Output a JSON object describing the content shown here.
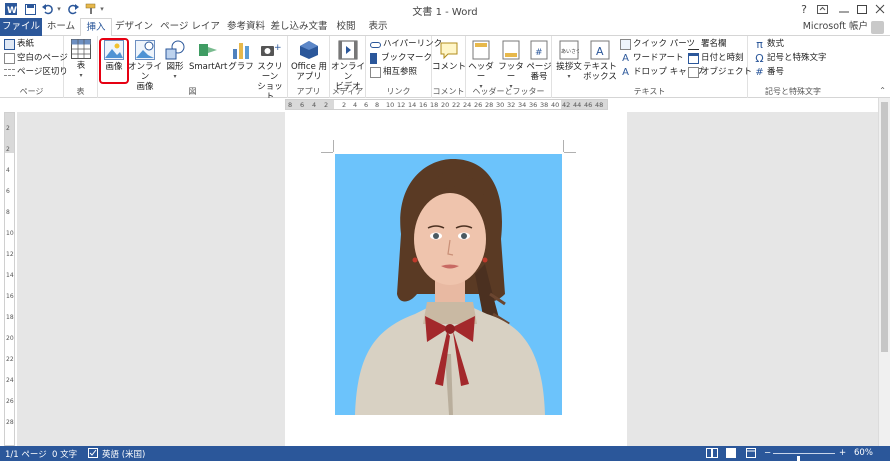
{
  "window": {
    "title": "文書 1 - Word",
    "help": "?",
    "account": "Microsoft 帳户"
  },
  "tabs": [
    {
      "label": "ファイル"
    },
    {
      "label": "ホーム"
    },
    {
      "label": "挿入"
    },
    {
      "label": "デザイン"
    },
    {
      "label": "ページ レイアウト"
    },
    {
      "label": "参考資料"
    },
    {
      "label": "差し込み文書"
    },
    {
      "label": "校閲"
    },
    {
      "label": "表示"
    }
  ],
  "ribbon": {
    "page_group": {
      "label": "ページ",
      "items": [
        "表紙",
        "空白のページ",
        "ページ区切り"
      ]
    },
    "table_group": {
      "label": "表",
      "table": "表"
    },
    "illustrations_group": {
      "label": "図",
      "picture": "画像",
      "online_picture_1": "オンライン",
      "online_picture_2": "画像",
      "shapes": "図形",
      "smartart": "SmartArt",
      "chart": "グラフ",
      "screenshot_1": "スクリーン",
      "screenshot_2": "ショット"
    },
    "apps_group": {
      "label": "アプリ",
      "office_apps_1": "Office 用",
      "office_apps_2": "アプリ"
    },
    "media_group": {
      "label": "メディア",
      "online_video_1": "オンライン",
      "online_video_2": "ビデオ"
    },
    "links_group": {
      "label": "リンク",
      "items": [
        "ハイパーリンク",
        "ブックマーク",
        "相互参照"
      ]
    },
    "comments_group": {
      "label": "コメント",
      "comment": "コメント"
    },
    "header_footer_group": {
      "label": "ヘッダーとフッター",
      "header": "ヘッダー",
      "footer": "フッター",
      "page_number_1": "ページ",
      "page_number_2": "番号"
    },
    "text_group": {
      "label": "テキスト",
      "greeting": "挨拶文",
      "textbox_1": "テキスト",
      "textbox_2": "ボックス",
      "quick_parts": "クイック パーツ",
      "wordart": "ワードアート",
      "dropcap": "ドロップ キャップ",
      "signature": "署名欄",
      "datetime": "日付と時刻",
      "object": "オブジェクト"
    },
    "symbols_group": {
      "label": "記号と特殊文字",
      "equation": "数式",
      "symbol": "記号と特殊文字",
      "number": "番号"
    }
  },
  "ruler": {
    "numbers_left": [
      "8",
      "6",
      "4",
      "2"
    ],
    "numbers_right": [
      "2",
      "4",
      "6",
      "8",
      "10",
      "12",
      "14",
      "16",
      "18",
      "20",
      "22",
      "24",
      "26",
      "28",
      "30",
      "32",
      "34",
      "36",
      "38",
      "40",
      "42",
      "44",
      "46",
      "48"
    ],
    "vertical": [
      "2",
      "2",
      "4",
      "6",
      "8",
      "10",
      "12",
      "14",
      "16",
      "18",
      "20",
      "22",
      "24",
      "26",
      "28"
    ]
  },
  "status": {
    "page": "1/1 ページ",
    "words": "0 文字",
    "language": "英語 (米国)",
    "zoom": "60%",
    "zoom_minus": "−",
    "zoom_plus": "+",
    "zoom_level": 0.4
  },
  "colors": {
    "brand": "#2b579a",
    "highlight": "#e60012",
    "photo_bg": "#6cc3fb"
  }
}
